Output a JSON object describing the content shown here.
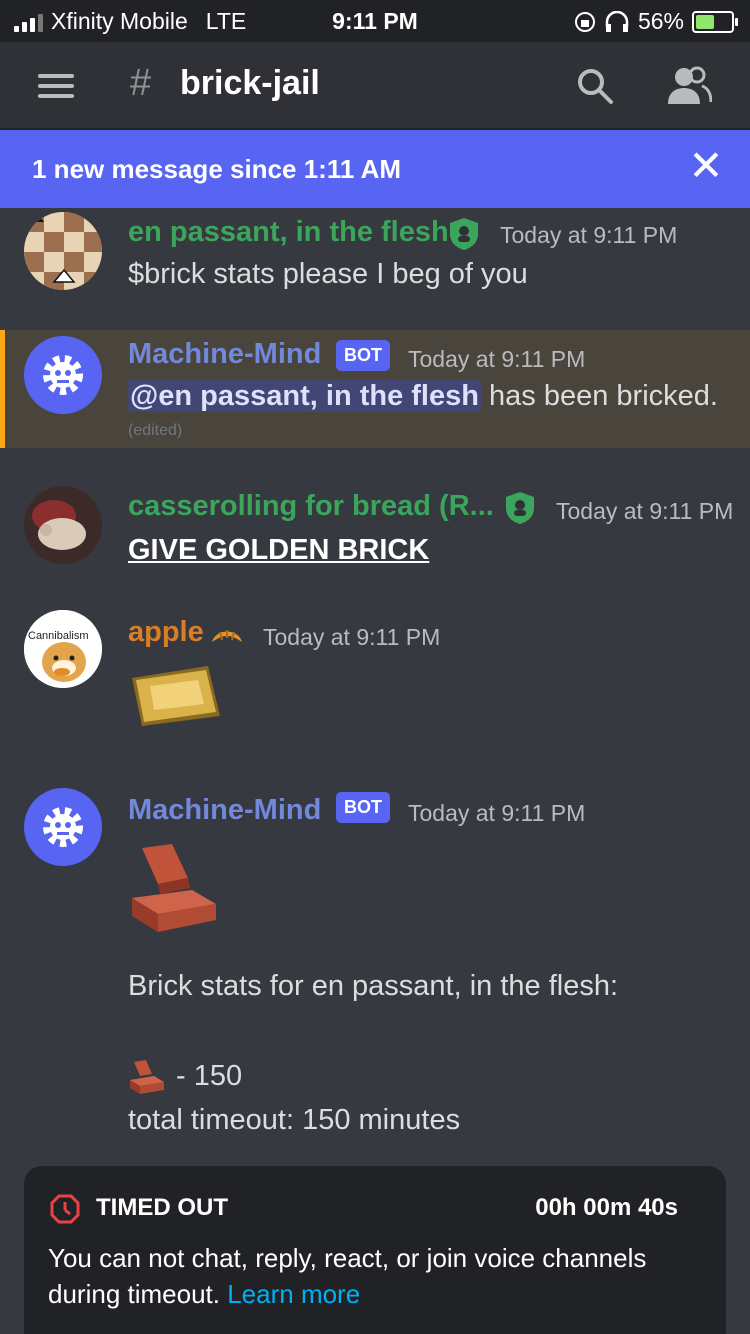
{
  "status_bar": {
    "carrier": "Xfinity Mobile",
    "network": "LTE",
    "time": "9:11 PM",
    "battery": "56%"
  },
  "header": {
    "hash": "#",
    "channel": "brick-jail"
  },
  "banner": {
    "text": "1 new message since 1:11 AM",
    "close": "✕"
  },
  "messages": [
    {
      "author": "en passant, in the flesh",
      "timestamp": "Today at 9:11 PM",
      "text": "$brick stats please I beg of you",
      "author_color": "#3ba55c"
    },
    {
      "author": "Machine-Mind",
      "tag": "BOT",
      "timestamp": "Today at 9:11 PM",
      "mention": "@en passant, in the flesh",
      "text": " has been bricked.",
      "edited": "(edited)",
      "author_color": "#7289da"
    },
    {
      "author": "casserolling for bread (R...",
      "timestamp": "Today at 9:11 PM",
      "text": "GIVE GOLDEN BRICK",
      "author_color": "#3ba55c"
    },
    {
      "author": "apple",
      "timestamp": "Today at 9:11 PM",
      "avatar_text": "Cannibalism",
      "author_color": "#d97d26"
    },
    {
      "author": "Machine-Mind",
      "tag": "BOT",
      "timestamp": "Today at 9:11 PM",
      "stats_line": "Brick stats for en passant, in the flesh:",
      "count": "- 150",
      "total": "total timeout: 150 minutes",
      "author_color": "#7289da"
    }
  ],
  "timeout": {
    "title": "TIMED OUT",
    "timer": "00h 00m 40s",
    "body": "You can not chat, reply, react, or join voice channels during timeout.",
    "link": "Learn more"
  }
}
